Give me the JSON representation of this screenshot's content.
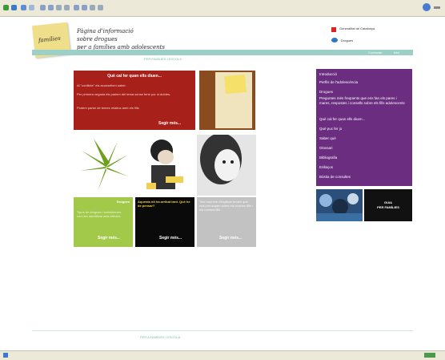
{
  "header": {
    "tagline": [
      "Pàgina d'informació",
      "sobre drogues",
      "per a famílies amb adolescents"
    ],
    "sticky_note": "famílies",
    "logo_top": "Generalitat de Catalunya",
    "logo_bottom": "Drogues",
    "topnav_links": [
      "Contactar",
      "Inici"
    ],
    "band_title": "PER FAMÍLIES I ESCOLA"
  },
  "content": {
    "red_box": {
      "title": "Què cal fer quan ells diuen...",
      "paragraphs": [
        "Al \"conflicte\" els aconsellem saber.",
        "Per primera vegada els parlem del tema sense tenir por ni dubtes.",
        "Podem parlar de temes relatius amb els fills"
      ],
      "readmore": "Segir més..."
    },
    "green_box": {
      "title": "Drogues",
      "body": "Tipus de drogues i substàncies, com les identificar dels efectes",
      "readmore": "Segir més..."
    },
    "black_box": {
      "title": "Aquesta nit ha arribat tard. Què he de pensar?",
      "readmore": "Segir més..."
    },
    "gray_box": {
      "body": "Tots hauríem d'explicar temes que ens preocupen sobre els nostres fills i els nostres fills",
      "readmore": "Segir més..."
    }
  },
  "sidebar": {
    "items": [
      "Introducció",
      "Perfils de l'adolescència",
      "Drogues",
      "Preguntes més freqüents que ens fan els pares i mares, respostes i consells sobre els fills adolescents",
      "Què cal fer quan ells diuen...",
      "Què puc fer jo",
      "Saber què",
      "Glossari",
      "Bibliografia",
      "Enllaços",
      "Bústia de consultes"
    ],
    "banner_label": [
      "GUIA",
      "PER FAMÍLIES"
    ]
  },
  "footer": {
    "text": "PER A FAMÍLIES I ESCOLA"
  },
  "colors": {
    "red": "#a8201a",
    "purple": "#6a2d80",
    "green": "#a3c94a",
    "teal": "#9ccfc6"
  }
}
